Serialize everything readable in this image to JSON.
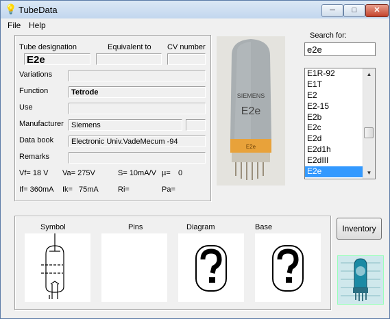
{
  "window": {
    "title": "TubeData"
  },
  "titlebar": {
    "minimize": "─",
    "maximize": "□",
    "close": "✕"
  },
  "menu": {
    "file": "File",
    "help": "Help"
  },
  "details": {
    "designation_label": "Tube designation",
    "designation_value": "E2e",
    "equivalent_label": "Equivalent to",
    "equivalent_value": "",
    "cv_label": "CV number",
    "cv_value": "",
    "variations_label": "Variations",
    "variations_value": "",
    "function_label": "Function",
    "function_value": "Tetrode",
    "use_label": "Use",
    "use_value": "",
    "manufacturer_label": "Manufacturer",
    "manufacturer_value": "Siemens",
    "manufacturer_extra": "",
    "databook_label": "Data book",
    "databook_value": "Electronic Univ.VadeMecum -94",
    "remarks_label": "Remarks",
    "remarks_value": ""
  },
  "params": {
    "vf": "Vf= 18 V",
    "va": "Va= 275V",
    "s": "S= 10mA/V",
    "mu": "µ=",
    "mu_val": "0",
    "if": "If= 360mA",
    "ik": "Ik=",
    "ik_val": "75mA",
    "ri": "Ri=",
    "pa": "Pa="
  },
  "photo": {
    "brand": "SIEMENS",
    "type": "E2e"
  },
  "search": {
    "label": "Search for:",
    "value": "e2e"
  },
  "tube_list": {
    "items": [
      "E1R-92",
      "E1T",
      "E2",
      "E2-15",
      "E2b",
      "E2c",
      "E2d",
      "E2d1h",
      "E2dIII",
      "E2e"
    ],
    "selected_index": 9
  },
  "scrollbar": {
    "up": "▲",
    "down": "▼"
  },
  "buttons": {
    "inventory": "Inventory"
  },
  "panels": {
    "symbol": "Symbol",
    "pins": "Pins",
    "diagram": "Diagram",
    "base": "Base"
  },
  "colors": {
    "selection": "#3399ff",
    "tube_band": "#e8a23a"
  }
}
